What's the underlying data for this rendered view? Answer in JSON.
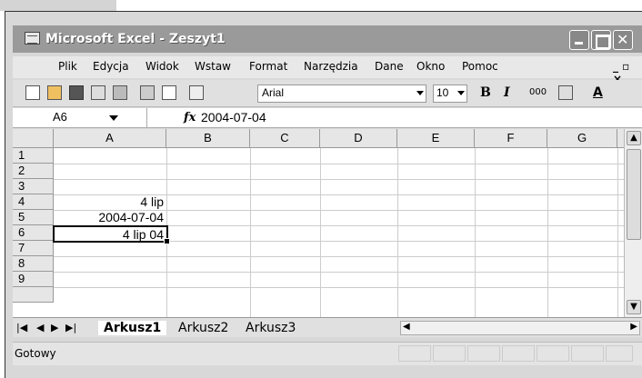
{
  "app": {
    "title": "Microsoft Excel - Zeszyt1"
  },
  "menu": {
    "items": [
      "Plik",
      "Edycja",
      "Widok",
      "Wstaw",
      "Format",
      "Narzędzia",
      "Dane",
      "Okno",
      "Pomoc"
    ]
  },
  "toolbar": {
    "font": "Arial",
    "size": "10",
    "bold": "B",
    "italic": "I",
    "thousands": "000",
    "font_color": "A"
  },
  "formula_bar": {
    "name_box": "A6",
    "fx": "fx",
    "value": "2004-07-04"
  },
  "grid": {
    "columns": [
      "A",
      "B",
      "C",
      "D",
      "E",
      "F",
      "G"
    ],
    "rows": [
      "1",
      "2",
      "3",
      "4",
      "5",
      "6",
      "7",
      "8",
      "9"
    ],
    "cells": {
      "A4": "4 lip",
      "A5": "2004-07-04",
      "A6": "4 lip 04"
    }
  },
  "sheets": {
    "tabs": [
      "Arkusz1",
      "Arkusz2",
      "Arkusz3"
    ],
    "active": "Arkusz1"
  },
  "status": {
    "text": "Gotowy"
  }
}
